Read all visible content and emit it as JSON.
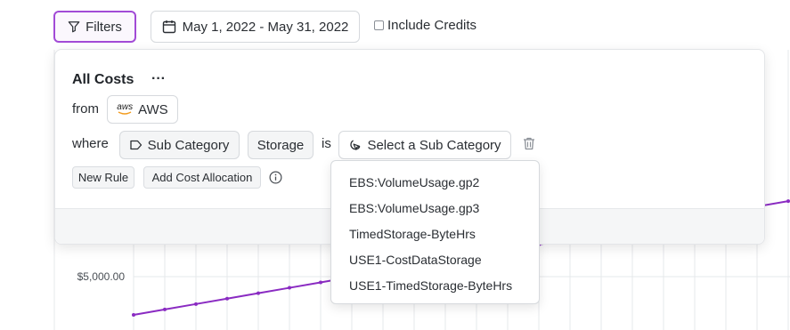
{
  "toolbar": {
    "filters_label": "Filters",
    "date_range": "May 1, 2022 - May 31, 2022",
    "include_credits_label": "Include Credits",
    "include_credits_checked": false
  },
  "panel": {
    "title": "All Costs",
    "more": "···",
    "from_label": "from",
    "source": {
      "logo_text": "aws",
      "label": "AWS"
    },
    "where_label": "where",
    "rule": {
      "dimension": "Sub Category",
      "value": "Storage",
      "operator": "is",
      "select_placeholder": "Select a Sub Category"
    },
    "new_rule_label": "New Rule",
    "add_allocation_label": "Add Cost Allocation"
  },
  "dropdown": {
    "options": [
      "EBS:VolumeUsage.gp2",
      "EBS:VolumeUsage.gp3",
      "TimedStorage-ByteHrs",
      "USE1-CostDataStorage",
      "USE1-TimedStorage-ByteHrs"
    ]
  },
  "chart": {
    "y_tick_label": "$5,000.00",
    "line_color": "#8a2bc2",
    "grid_color": "#e6e8eb"
  }
}
